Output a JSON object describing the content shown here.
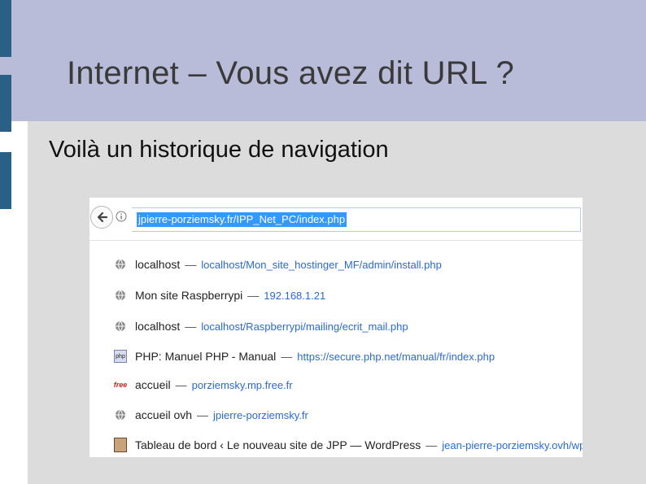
{
  "slide": {
    "title": "Internet – Vous avez dit URL ?",
    "subtitle": "Voilà un historique de navigation"
  },
  "browser": {
    "url": "jpierre-porziemsky.fr/IPP_Net_PC/index.php",
    "history": [
      {
        "title": "localhost",
        "url": "localhost/Mon_site_hostinger_MF/admin/install.php",
        "icon": "globe-icon"
      },
      {
        "title": "Mon site Raspberrypi",
        "url": "192.168.1.21",
        "icon": "globe-icon"
      },
      {
        "title": "localhost",
        "url": "localhost/Raspberrypi/mailing/ecrit_mail.php",
        "icon": "globe-icon"
      },
      {
        "title": "PHP: Manuel PHP - Manual",
        "url": "https://secure.php.net/manual/fr/index.php",
        "icon": "php-icon"
      },
      {
        "title": "accueil",
        "url": "porziemsky.mp.free.fr",
        "icon": "free-icon"
      },
      {
        "title": "accueil ovh",
        "url": "jpierre-porziemsky.fr",
        "icon": "globe-icon"
      },
      {
        "title": "Tableau de bord ‹ Le nouveau site de JPP — WordPress",
        "url": "jean-pierre-porziemsky.ovh/wp-admin/",
        "icon": "avatar-icon"
      }
    ],
    "separator": "—",
    "php_badge": "php",
    "free_badge": "free"
  }
}
